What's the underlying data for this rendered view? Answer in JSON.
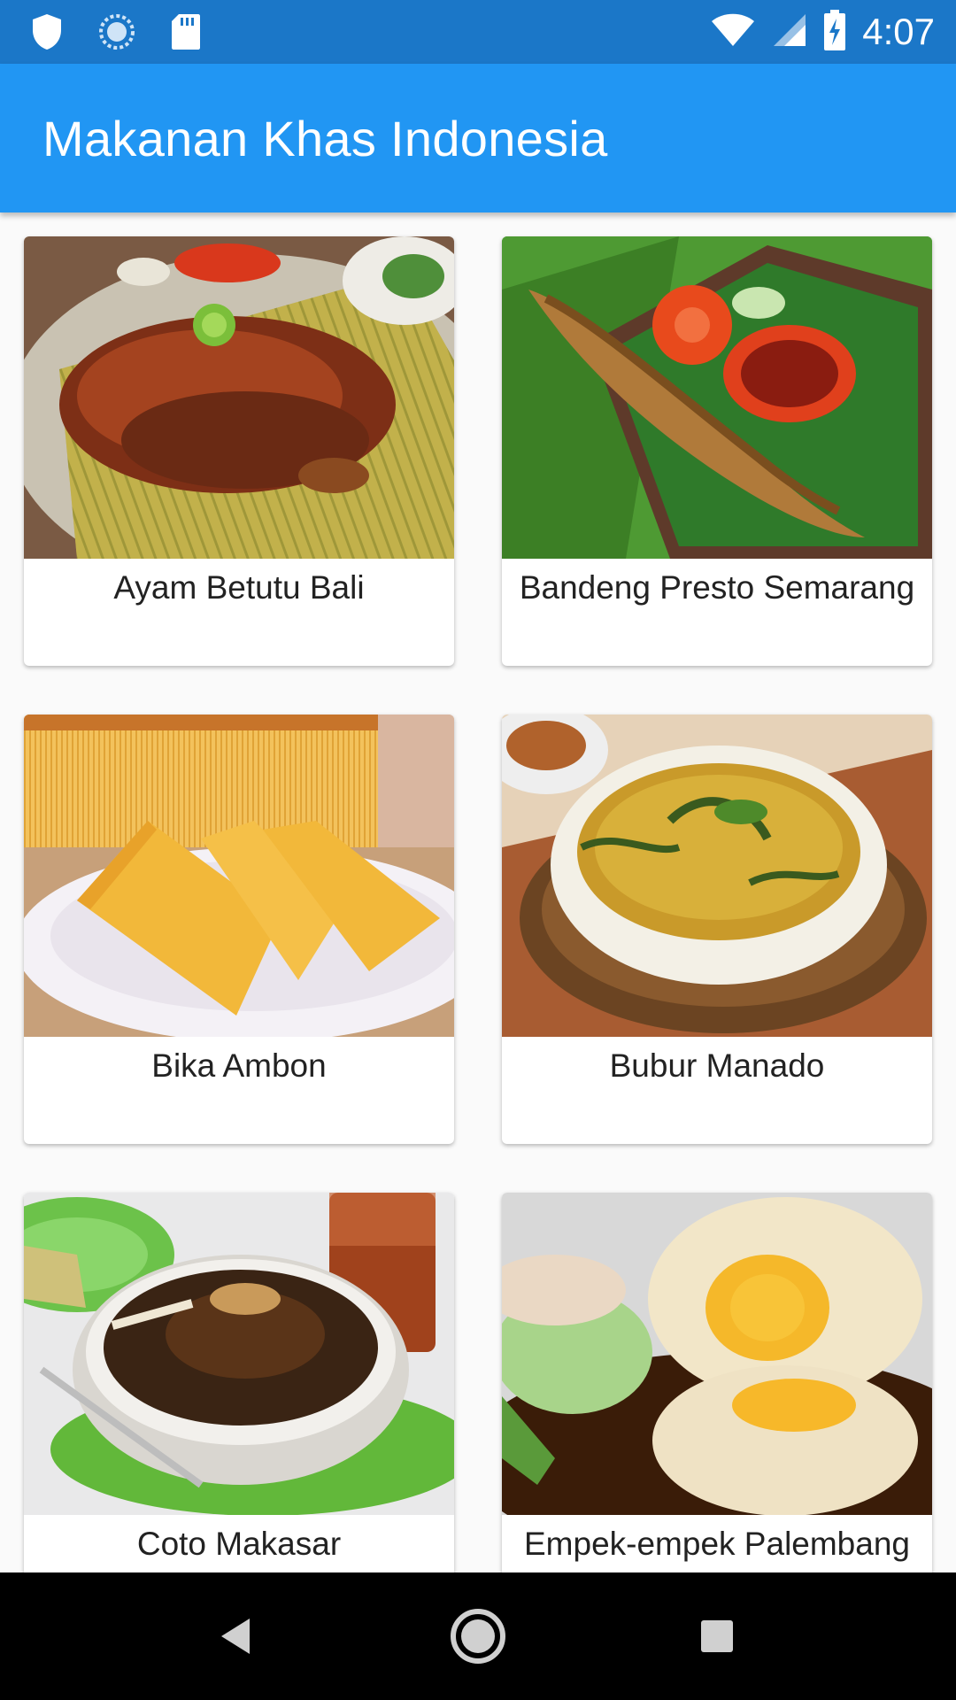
{
  "status_bar": {
    "time": "4:07",
    "left_icons": [
      "shield-icon",
      "sync-icon",
      "sd-card-icon"
    ],
    "right_icons": [
      "wifi-icon",
      "cell-signal-icon",
      "battery-charging-icon"
    ]
  },
  "app_bar": {
    "title": "Makanan Khas Indonesia",
    "color": "#2196f3"
  },
  "foods": [
    {
      "name": "Ayam Betutu Bali",
      "image": "ayam-betutu-image"
    },
    {
      "name": "Bandeng Presto Semarang",
      "image": "bandeng-presto-image"
    },
    {
      "name": "Bika Ambon",
      "image": "bika-ambon-image"
    },
    {
      "name": "Bubur Manado",
      "image": "bubur-manado-image"
    },
    {
      "name": "Coto Makasar",
      "image": "coto-makasar-image"
    },
    {
      "name": "Empek-empek Palembang",
      "image": "empek-empek-image"
    }
  ],
  "nav_bar": {
    "buttons": [
      "back-icon",
      "home-icon",
      "recents-icon"
    ]
  }
}
